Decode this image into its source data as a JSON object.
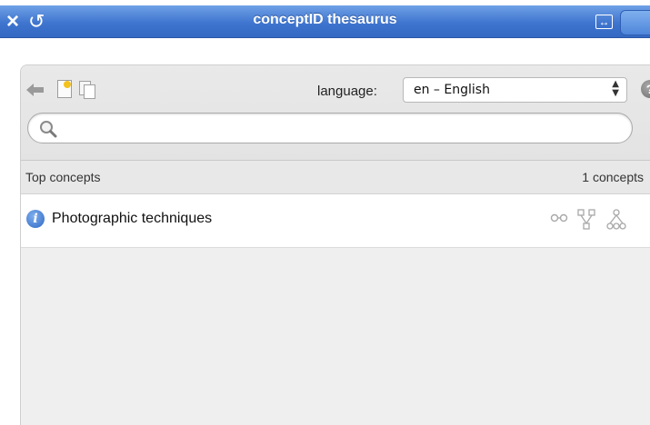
{
  "titlebar": {
    "close_icon": "×",
    "refresh_icon": "↺",
    "title": "conceptID thesaurus",
    "expand_icon": "↔"
  },
  "toolbar": {
    "icons": [
      "back-arrow-icon",
      "new-document-icon",
      "copy-icon"
    ],
    "language_label": "language:",
    "language_value": "en – English",
    "help_icon": "?"
  },
  "search": {
    "placeholder": "",
    "value": ""
  },
  "list": {
    "header_left": "Top concepts",
    "header_right": "1 concepts",
    "items": [
      {
        "label": "Photographic techniques"
      }
    ]
  },
  "colors": {
    "titlebar": "#3f75cf",
    "panel_bg": "#efefef",
    "info_icon": "#2f67c4"
  }
}
